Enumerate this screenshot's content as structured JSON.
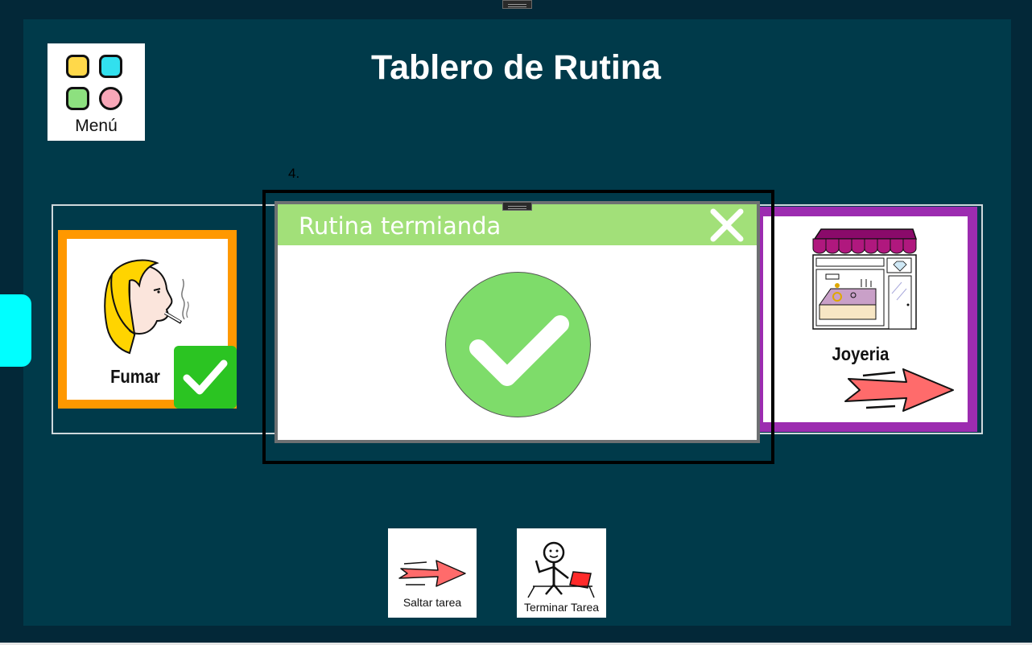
{
  "header": {
    "title": "Tablero de Rutina",
    "menu_label": "Menú"
  },
  "step": {
    "number": "4."
  },
  "routine": {
    "cards": [
      {
        "label": "Fumar",
        "icon": "woman-smoking-icon",
        "border_color": "#ff9800",
        "completed": true
      },
      {
        "label": "Joyeria",
        "icon": "jewelry-shop-icon",
        "border_color": "#9c2cb0",
        "completed": false
      }
    ]
  },
  "modal": {
    "title": "Rutina termianda",
    "close_icon": "close-icon",
    "status_icon": "check-circle-icon",
    "header_color": "#a2e079",
    "check_color": "#7edc6a"
  },
  "actions": {
    "skip_label": "Saltar tarea",
    "finish_label": "Terminar Tarea"
  },
  "colors": {
    "background": "#003a4a",
    "side_tab": "#00ffff",
    "done_badge": "#2bc422"
  }
}
